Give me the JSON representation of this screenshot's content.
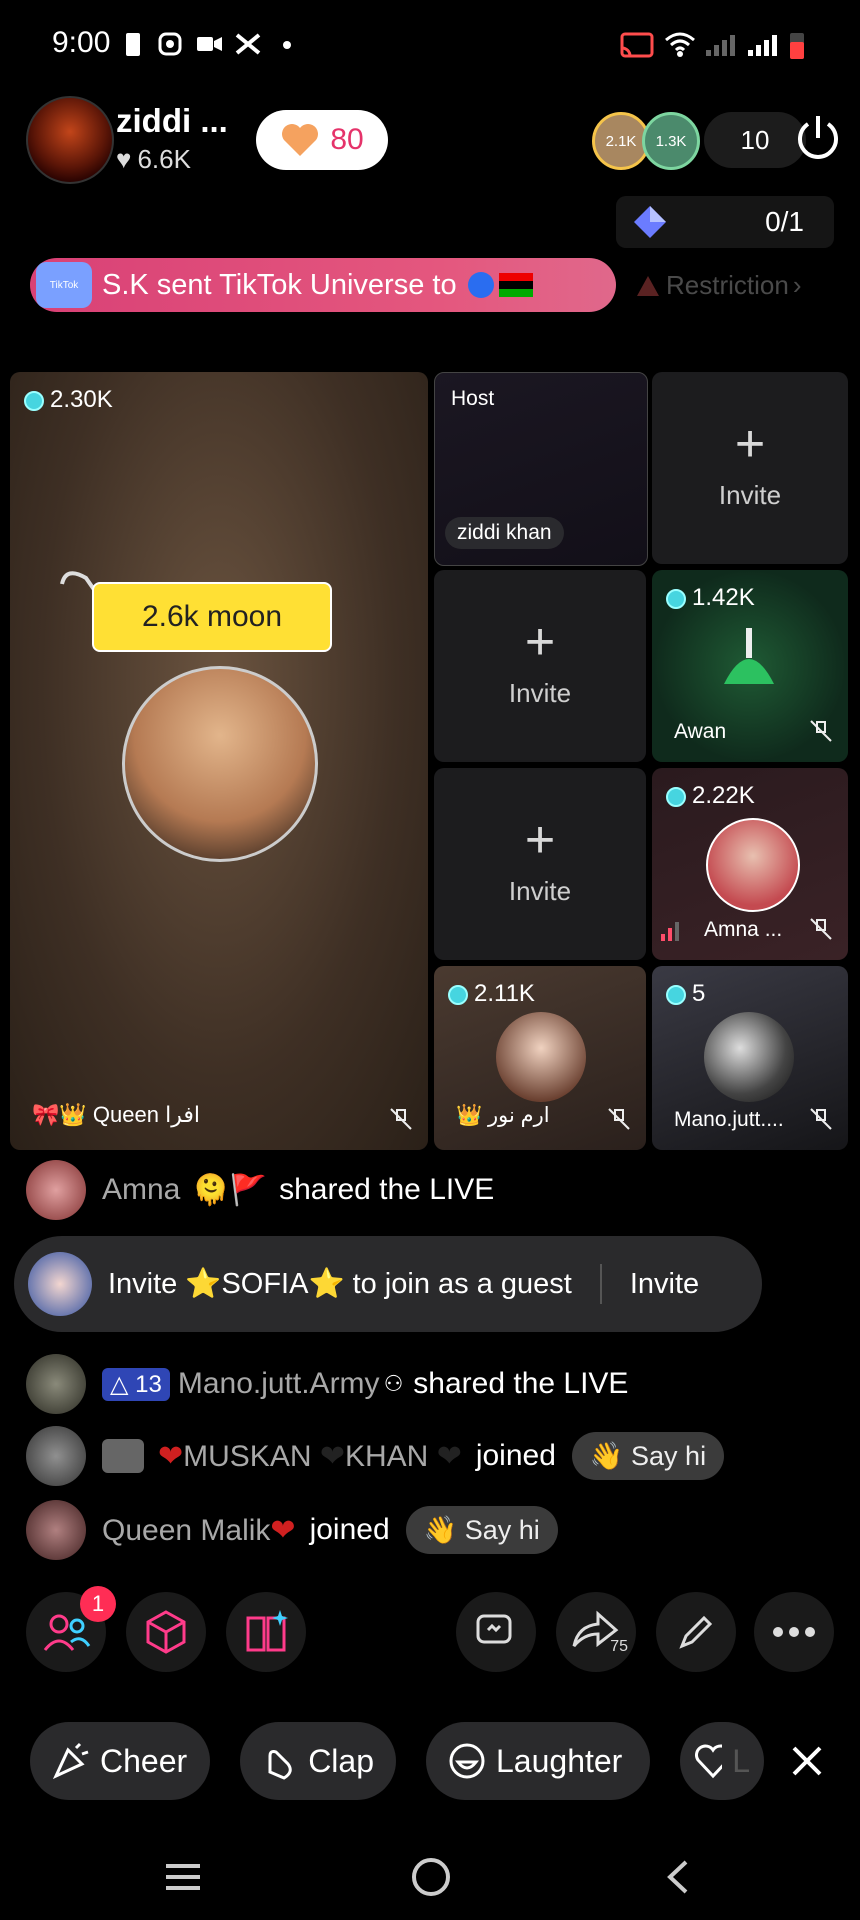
{
  "status": {
    "time": "9:00"
  },
  "host": {
    "name": "ziddi ...",
    "likes": "6.6K",
    "like_pill": "80"
  },
  "viewers": {
    "top1": "2.1K",
    "top2": "1.3K",
    "count": "10"
  },
  "progress": {
    "value": "0/1"
  },
  "gift_banner": {
    "text": "S.K sent TikTok Universe to",
    "icon_text": "TikTok"
  },
  "restriction": "Restriction",
  "grid": {
    "main": {
      "score": "2.30K",
      "tag": "2.6k moon",
      "name": "Queen افرا"
    },
    "host_tile": {
      "label": "Host",
      "name": "ziddi khan"
    },
    "invite_label": "Invite",
    "awan": {
      "score": "1.42K",
      "name": "Awan"
    },
    "amna": {
      "score": "2.22K",
      "name": "Amna ..."
    },
    "iram": {
      "score": "2.11K",
      "name": "ارم نور"
    },
    "mano": {
      "score": "5",
      "name": "Mano.jutt...."
    }
  },
  "comments": {
    "c1": {
      "name": "Amna",
      "action": "shared the LIVE"
    },
    "invite": {
      "text_pre": "Invite",
      "guest": "SOFIA",
      "text_post": "to join as a guest",
      "button": "Invite"
    },
    "c2": {
      "level": "13",
      "name": "Mano.jutt.Army",
      "action": "shared the LIVE"
    },
    "c3": {
      "name1": "MUSKAN",
      "name2": "KHAN",
      "action": "joined",
      "sayhi": "Say hi"
    },
    "c4": {
      "name": "Queen Malik",
      "action": "joined",
      "sayhi": "Say hi"
    }
  },
  "toolbar": {
    "notification_count": "1",
    "share_count": "75"
  },
  "chips": {
    "cheer": "Cheer",
    "clap": "Clap",
    "laughter": "Laughter",
    "love": "L"
  },
  "colors": {
    "accent": "#ff2d55",
    "banner": "#e4577e",
    "coin": "#46d5e0",
    "tag": "#ffe034"
  }
}
